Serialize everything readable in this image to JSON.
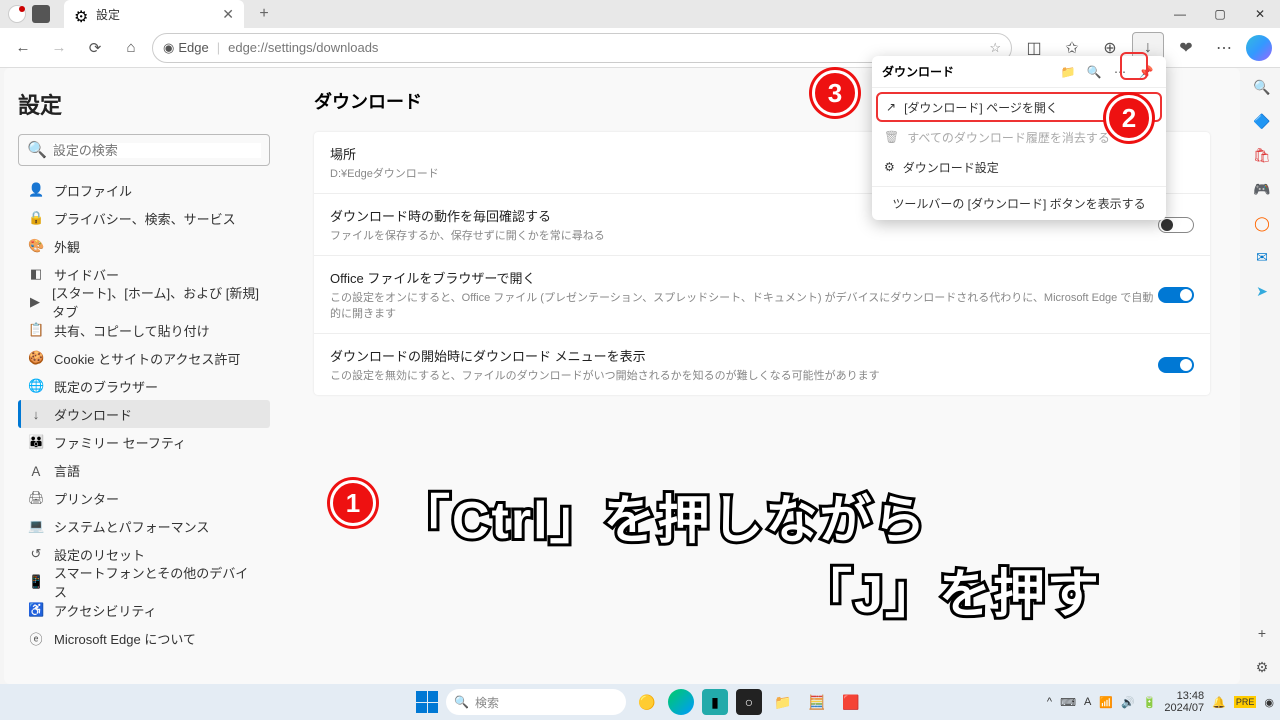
{
  "titlebar": {
    "tab_title": "設定"
  },
  "addr": {
    "brand": "Edge",
    "url": "edge://settings/downloads"
  },
  "settings": {
    "header": "設定",
    "search_placeholder": "設定の検索",
    "nav": [
      "プロファイル",
      "プライバシー、検索、サービス",
      "外観",
      "サイドバー",
      "[スタート]、[ホーム]、および [新規] タブ",
      "共有、コピーして貼り付け",
      "Cookie とサイトのアクセス許可",
      "既定のブラウザー",
      "ダウンロード",
      "ファミリー セーフティ",
      "言語",
      "プリンター",
      "システムとパフォーマンス",
      "設定のリセット",
      "スマートフォンとその他のデバイス",
      "アクセシビリティ",
      "Microsoft Edge について"
    ]
  },
  "page": {
    "title": "ダウンロード",
    "location_label": "場所",
    "location_value": "D:¥Edgeダウンロード",
    "rows": [
      {
        "title": "ダウンロード時の動作を毎回確認する",
        "sub": "ファイルを保存するか、保存せずに開くかを常に尋ねる",
        "on": false
      },
      {
        "title": "Office ファイルをブラウザーで開く",
        "sub": "この設定をオンにすると、Office ファイル (プレゼンテーション、スプレッドシート、ドキュメント) がデバイスにダウンロードされる代わりに、Microsoft Edge で自動的に開きます",
        "on": true
      },
      {
        "title": "ダウンロードの開始時にダウンロード メニューを表示",
        "sub": "この設定を無効にすると、ファイルのダウンロードがいつ開始されるかを知るのが難しくなる可能性があります",
        "on": true
      }
    ]
  },
  "dl_popup": {
    "title": "ダウンロード",
    "open_page": "[ダウンロード] ページを開く",
    "clear_history": "すべてのダウンロード履歴を消去する",
    "settings": "ダウンロード設定",
    "show_toolbar": "ツールバーの [ダウンロード] ボタンを表示する"
  },
  "annotation": {
    "line1": "「Ctrl」を押しながら",
    "line2": "「J」を押す"
  },
  "taskbar": {
    "search": "検索",
    "time": "13:48",
    "date": "2024/07"
  }
}
